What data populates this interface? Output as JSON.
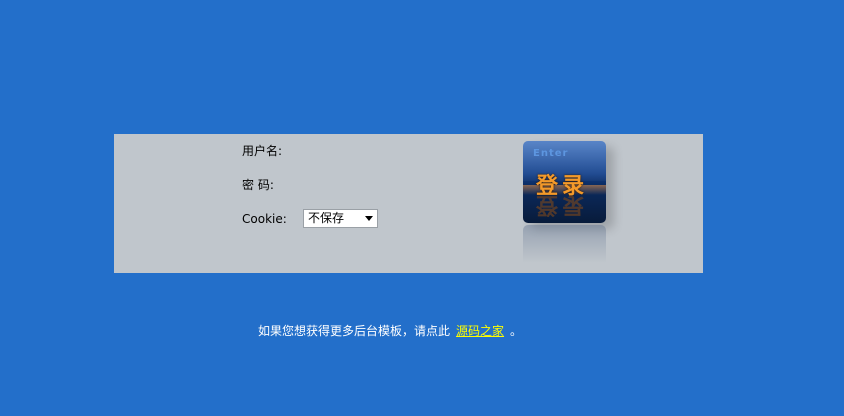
{
  "login": {
    "username_label": "用户名:",
    "password_label": "密  码:",
    "cookie_label": "Cookie:",
    "cookie_selected": "不保存",
    "button_enter_text": "Enter",
    "button_login_text": "登录"
  },
  "footer": {
    "prefix_text": "如果您想获得更多后台模板，请点此",
    "link_text": "源码之家",
    "suffix_text": "。"
  },
  "colors": {
    "page_background": "#236fca",
    "panel_background": "#c0c6cc",
    "link": "#ffff00",
    "button_text": "#f49a2a"
  }
}
